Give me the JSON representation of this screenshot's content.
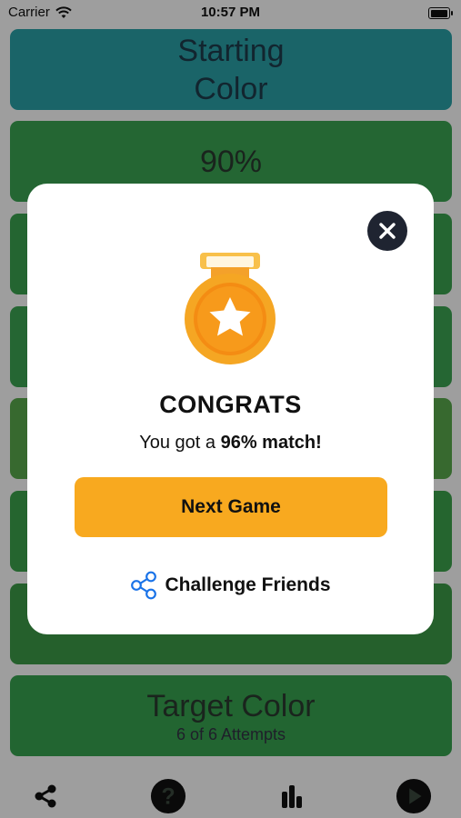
{
  "status_bar": {
    "carrier": "Carrier",
    "time": "10:57 PM"
  },
  "rows": {
    "starting": "Starting\nColor",
    "percent": "90%",
    "target_title": "Target Color",
    "target_sub": "6 of 6 Attempts"
  },
  "modal": {
    "title": "CONGRATS",
    "match_prefix": "You got a ",
    "match_value": "96% match!",
    "next_button": "Next Game",
    "challenge_label": "Challenge Friends"
  },
  "tabbar": {
    "icons": [
      "share-icon",
      "help-icon",
      "stats-icon",
      "play-icon"
    ]
  },
  "colors": {
    "accent": "#f8a91f",
    "link_blue": "#1a73e8",
    "dark": "#1f2431"
  }
}
